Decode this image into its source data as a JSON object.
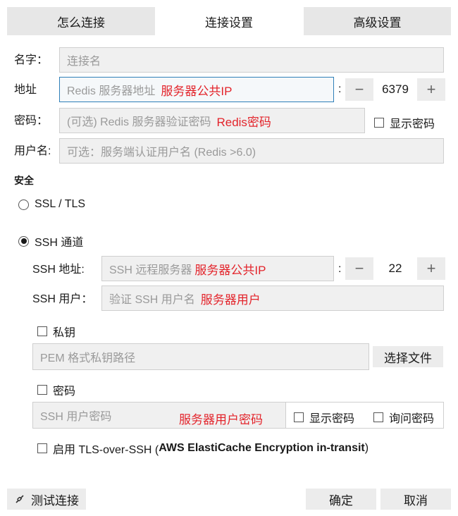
{
  "tabs": [
    {
      "label": "怎么连接",
      "active": false
    },
    {
      "label": "连接设置",
      "active": true
    },
    {
      "label": "高级设置",
      "active": false
    }
  ],
  "form": {
    "name_label": "名字：",
    "name_placeholder": "连接名",
    "address_label": "地址",
    "address_placeholder": "Redis 服务器地址",
    "address_annotation": "服务器公共IP",
    "port_colon": ":",
    "port_value": "6379",
    "password_label": "密码：",
    "password_placeholder": "(可选) Redis 服务器验证密码",
    "password_annotation": "Redis密码",
    "show_password_label": "显示密码",
    "username_label": "用户名:",
    "username_placeholder": "可选：服务端认证用户名 (Redis >6.0)"
  },
  "security": {
    "title": "安全",
    "ssl_label": "SSL / TLS",
    "ssh_label": "SSH 通道",
    "selected": "ssh"
  },
  "ssh": {
    "address_label": "SSH 地址:",
    "address_placeholder": "SSH 远程服务器",
    "address_annotation": "服务器公共IP",
    "port_colon": ":",
    "port_value": "22",
    "user_label": "SSH 用户：",
    "user_placeholder": "验证 SSH 用户名",
    "user_annotation": "服务器用户",
    "private_key_label": "私钥",
    "private_key_placeholder": "PEM 格式私钥路径",
    "choose_file_label": "选择文件",
    "password_label": "密码",
    "password_placeholder": "SSH 用户密码",
    "password_annotation": "服务器用户密码",
    "show_password_label": "显示密码",
    "ask_password_label": "询问密码",
    "tls_over_ssh_prefix": "启用 TLS-over-SSH (",
    "tls_over_ssh_bold": "AWS ElastiCache Encryption in-transit",
    "tls_over_ssh_suffix": ")"
  },
  "footer": {
    "test_connection_label": "测试连接",
    "ok_label": "确定",
    "cancel_label": "取消"
  },
  "icons": {
    "test_connection": "plug-link-icon",
    "stepper_minus": "minus-icon",
    "stepper_plus": "plus-icon"
  },
  "colors": {
    "annotation": "#e3242b",
    "focus_border": "#2f7fb8",
    "tab_inactive": "#e7e7e7",
    "field_bg": "#f0f0f0"
  }
}
